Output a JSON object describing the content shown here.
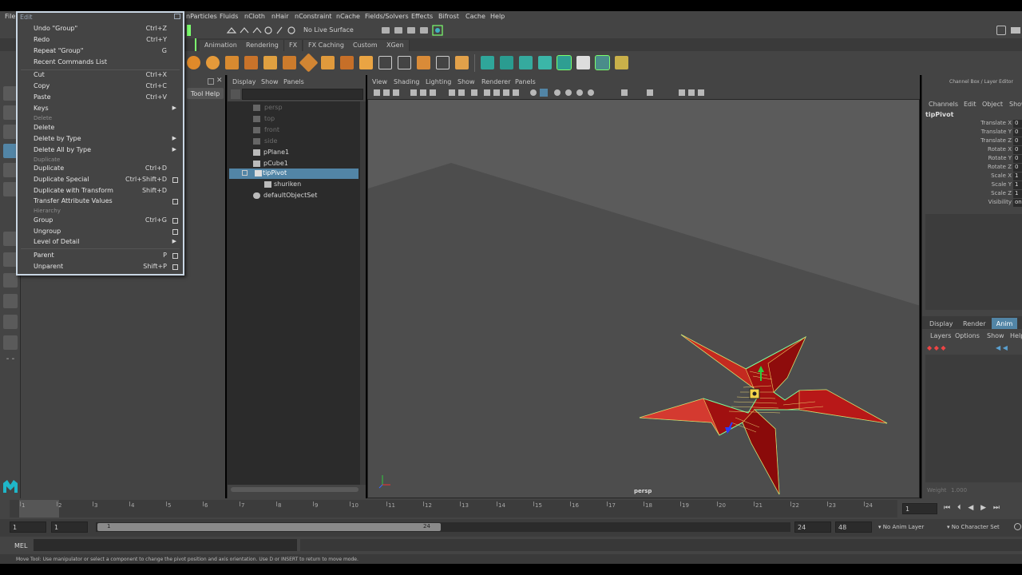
{
  "menubar": {
    "items": [
      "File",
      "nParticles",
      "Fluids",
      "nCloth",
      "nHair",
      "nConstraint",
      "nCache",
      "Fields/Solvers",
      "Effects",
      "Bifrost",
      "Cache",
      "Help"
    ]
  },
  "status_line": {
    "live_surface": "No Live Surface"
  },
  "shelf_tabs": [
    "Animation",
    "Rendering",
    "FX",
    "FX Caching",
    "Custom",
    "XGen"
  ],
  "edit_menu": {
    "title": "Edit",
    "items": [
      {
        "label": "Undo \"Group\"",
        "shortcut": "Ctrl+Z"
      },
      {
        "label": "Redo",
        "shortcut": "Ctrl+Y"
      },
      {
        "label": "Repeat \"Group\"",
        "shortcut": "G"
      },
      {
        "label": "Recent Commands List",
        "shortcut": ""
      },
      {
        "label": "Cut",
        "shortcut": "Ctrl+X"
      },
      {
        "label": "Copy",
        "shortcut": "Ctrl+C"
      },
      {
        "label": "Paste",
        "shortcut": "Ctrl+V"
      },
      {
        "label": "Keys",
        "shortcut": ""
      },
      {
        "label": "Delete",
        "shortcut": ""
      },
      {
        "label": "Delete",
        "shortcut": ""
      },
      {
        "label": "Delete by Type",
        "shortcut": ""
      },
      {
        "label": "Delete All by Type",
        "shortcut": ""
      },
      {
        "label": "Duplicate",
        "shortcut": ""
      },
      {
        "label": "Duplicate",
        "shortcut": "Ctrl+D"
      },
      {
        "label": "Duplicate Special",
        "shortcut": "Ctrl+Shift+D"
      },
      {
        "label": "Duplicate with Transform",
        "shortcut": "Shift+D"
      },
      {
        "label": "Transfer Attribute Values",
        "shortcut": ""
      },
      {
        "label": "Hierarchy",
        "shortcut": ""
      },
      {
        "label": "Group",
        "shortcut": "Ctrl+G"
      },
      {
        "label": "Ungroup",
        "shortcut": ""
      },
      {
        "label": "Level of Detail",
        "shortcut": ""
      },
      {
        "label": "Parent",
        "shortcut": "P"
      },
      {
        "label": "Unparent",
        "shortcut": "Shift+P"
      }
    ]
  },
  "tool_settings": {
    "tool_help": "Tool Help"
  },
  "outliner": {
    "menu": [
      "Display",
      "Show",
      "Panels"
    ],
    "items": [
      "persp",
      "top",
      "front",
      "side",
      "pPlane1",
      "pCube1",
      "tipPivot",
      "shuriken",
      "defaultObjectSet"
    ],
    "selected": "tipPivot"
  },
  "viewport": {
    "menu": [
      "View",
      "Shading",
      "Lighting",
      "Show",
      "Renderer",
      "Panels"
    ],
    "camera_label": "persp"
  },
  "channel_box": {
    "header": "Channel Box / Layer Editor",
    "menu": [
      "Channels",
      "Edit",
      "Object",
      "Show"
    ],
    "object_name": "tipPivot",
    "channels": [
      {
        "name": "Translate X",
        "value": "0"
      },
      {
        "name": "Translate Y",
        "value": "0"
      },
      {
        "name": "Translate Z",
        "value": "0"
      },
      {
        "name": "Rotate X",
        "value": "0"
      },
      {
        "name": "Rotate Y",
        "value": "0"
      },
      {
        "name": "Rotate Z",
        "value": "0"
      },
      {
        "name": "Scale X",
        "value": "1"
      },
      {
        "name": "Scale Y",
        "value": "1"
      },
      {
        "name": "Scale Z",
        "value": "1"
      },
      {
        "name": "Visibility",
        "value": "on"
      }
    ],
    "layer_tabs": [
      "Display",
      "Render",
      "Anim"
    ],
    "active_layer_tab": "Anim",
    "layer_menu": [
      "Layers",
      "Options",
      "Show",
      "Help"
    ],
    "weight_label": "Weight",
    "weight_value": "1.000"
  },
  "time_slider": {
    "ticks": [
      "1",
      "2",
      "3",
      "4",
      "5",
      "6",
      "7",
      "8",
      "9",
      "10",
      "11",
      "12",
      "13",
      "14",
      "15",
      "16",
      "17",
      "18",
      "19",
      "20",
      "21",
      "22",
      "23",
      "24"
    ],
    "current_frame": "1"
  },
  "range_slider": {
    "start": "1",
    "start_inner": "1",
    "range_start_label": "1",
    "range_end_label": "24",
    "end_inner": "24",
    "end": "48",
    "anim_layer": "No Anim Layer",
    "character_set": "No Character Set"
  },
  "command_line": {
    "label": "MEL"
  },
  "help_line": {
    "text": "Move Tool: Use manipulator or select a component to change the pivot position and axis orientation. Use D or INSERT to return to move mode."
  },
  "colors": {
    "accent_blue": "#5285a6",
    "shuriken_red": "#a01010",
    "wire_green": "#7cff9b",
    "maya_logo": "#1fb6c8"
  }
}
